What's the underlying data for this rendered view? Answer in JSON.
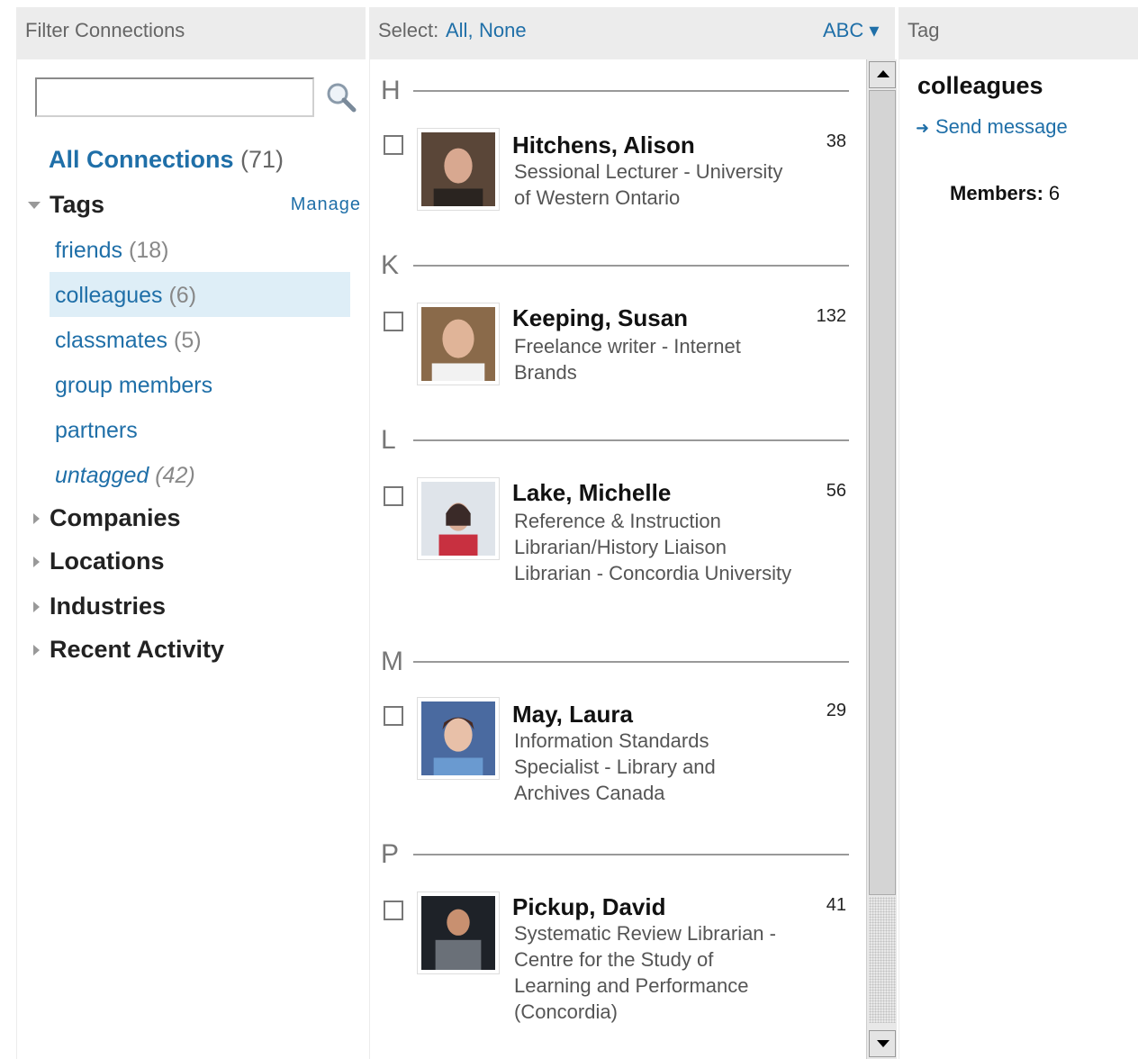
{
  "header": {
    "filter_label": "Filter Connections",
    "select_label": "Select:",
    "select_all": "All,",
    "select_none": "None",
    "sort_label": "ABC ▾",
    "tag_label": "Tag"
  },
  "search": {
    "value": "",
    "placeholder": ""
  },
  "sidebar": {
    "all_connections_label": "All Connections",
    "all_connections_count": "(71)",
    "tags_title": "Tags",
    "manage_label": "Manage",
    "tags": [
      {
        "label": "friends",
        "count": "(18)"
      },
      {
        "label": "colleagues",
        "count": "(6)"
      },
      {
        "label": "classmates",
        "count": "(5)"
      },
      {
        "label": "group members",
        "count": ""
      },
      {
        "label": "partners",
        "count": ""
      },
      {
        "label": "untagged",
        "count": "(42)"
      }
    ],
    "categories": [
      "Companies",
      "Locations",
      "Industries",
      "Recent Activity"
    ]
  },
  "contacts": [
    {
      "letter": "H",
      "name": "Hitchens, Alison",
      "title": "Sessional Lecturer - University of Western Ontario",
      "count": "38",
      "photo_color": "#5a4638"
    },
    {
      "letter": "K",
      "name": "Keeping, Susan",
      "title": "Freelance writer - Internet Brands",
      "count": "132",
      "photo_color": "#8a6a4a"
    },
    {
      "letter": "L",
      "name": "Lake, Michelle",
      "title": "Reference & Instruction Librarian/History Liaison Librarian - Concordia University",
      "count": "56",
      "photo_color": "#b04050"
    },
    {
      "letter": "M",
      "name": "May, Laura",
      "title": "Information Standards Specialist - Library and Archives Canada",
      "count": "29",
      "photo_color": "#4a6aa0"
    },
    {
      "letter": "P",
      "name": "Pickup, David",
      "title": "Systematic Review Librarian - Centre for the Study of Learning and Performance (Concordia)",
      "count": "41",
      "photo_color": "#3a3a3a"
    }
  ],
  "tag_panel": {
    "tag_name": "colleagues",
    "send_message": "Send message",
    "members_label": "Members:",
    "members_count": "6"
  },
  "colors": {
    "link": "#1f6fa8",
    "selected_bg": "#deeef7",
    "header_bg": "#ececec"
  }
}
